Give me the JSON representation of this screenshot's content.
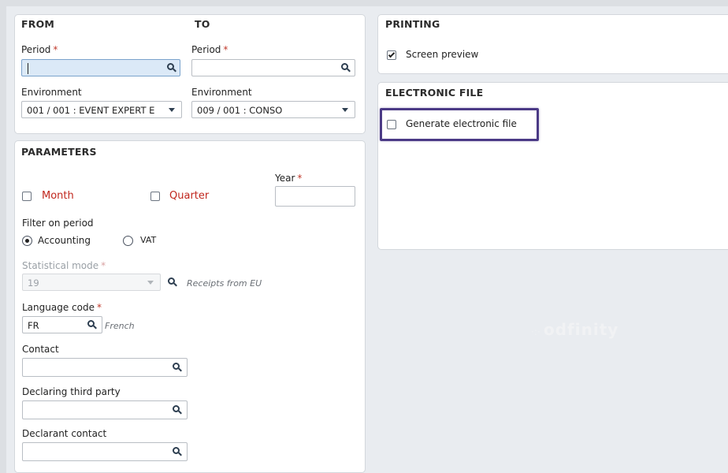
{
  "from": {
    "title": "FROM",
    "period_label": "Period",
    "period_value": "",
    "environment_label": "Environment",
    "environment_value": "001 / 001 : EVENT EXPERT E"
  },
  "to": {
    "title": "TO",
    "period_label": "Period",
    "period_value": "",
    "environment_label": "Environment",
    "environment_value": "009 / 001 : CONSO"
  },
  "required_marker": "*",
  "parameters": {
    "title": "PARAMETERS",
    "year_label": "Year",
    "year_value": "",
    "month_label": "Month",
    "month_checked": false,
    "quarter_label": "Quarter",
    "quarter_checked": false,
    "filter_label": "Filter on period",
    "filter_options": [
      "Accounting",
      "VAT"
    ],
    "filter_selected": "Accounting",
    "statistical_mode_label": "Statistical mode",
    "statistical_mode_value": "19",
    "statistical_mode_desc": "Receipts from EU",
    "language_code_label": "Language code",
    "language_code_value": "FR",
    "language_code_desc": "French",
    "contact_label": "Contact",
    "contact_value": "",
    "declaring_third_party_label": "Declaring third party",
    "declaring_third_party_value": "",
    "declarant_contact_label": "Declarant contact",
    "declarant_contact_value": ""
  },
  "printing": {
    "title": "PRINTING",
    "screen_preview_label": "Screen preview",
    "screen_preview_checked": true
  },
  "electronic_file": {
    "title": "ELECTRONIC FILE",
    "generate_label": "Generate electronic file",
    "generate_checked": false
  },
  "watermark": {
    "text": "odfinity",
    "dots": "·:·"
  },
  "colors": {
    "required": "#c0392b",
    "month_quarter_label": "#c0261d",
    "highlight_border": "#4b3a86",
    "focused_field": "#dbe9f7"
  }
}
